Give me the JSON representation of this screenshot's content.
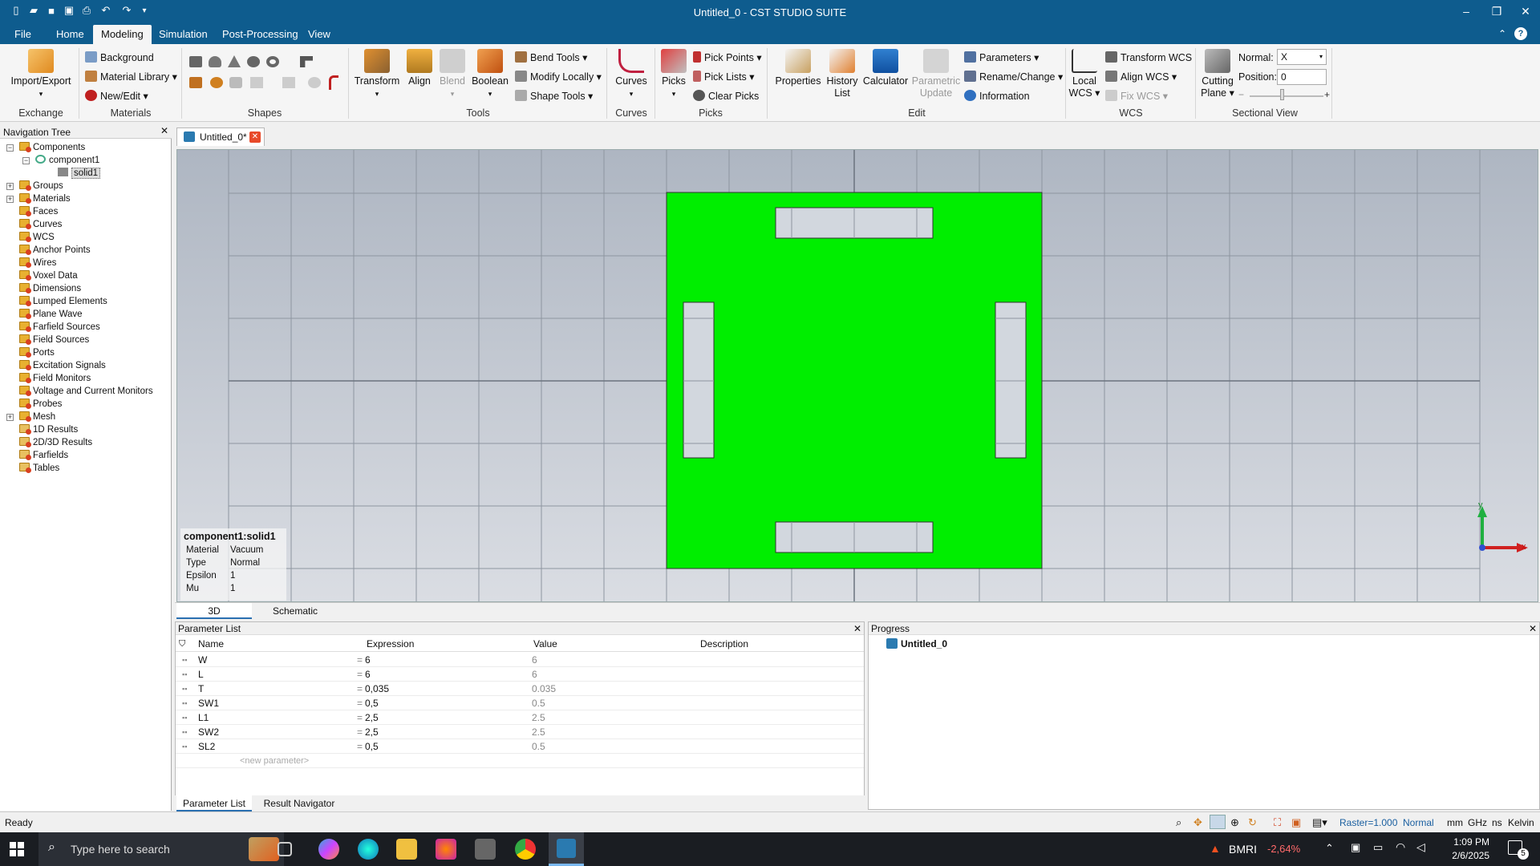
{
  "app": {
    "title": "Untitled_0 - CST STUDIO SUITE"
  },
  "menu": {
    "tabs": [
      "File",
      "Home",
      "Modeling",
      "Simulation",
      "Post-Processing",
      "View"
    ],
    "active": "Modeling"
  },
  "ribbon": {
    "exchange": {
      "import_export": "Import/Export",
      "label": "Exchange"
    },
    "materials": {
      "background": "Background",
      "material_library": "Material Library",
      "new_edit": "New/Edit",
      "label": "Materials"
    },
    "shapes": {
      "label": "Shapes"
    },
    "tools": {
      "transform": "Transform",
      "align": "Align",
      "blend": "Blend",
      "boolean": "Boolean",
      "bend_tools": "Bend Tools",
      "modify_locally": "Modify Locally",
      "shape_tools": "Shape Tools",
      "label": "Tools"
    },
    "curves": {
      "curves": "Curves",
      "label": "Curves"
    },
    "picks": {
      "picks": "Picks",
      "pick_points": "Pick Points",
      "pick_lists": "Pick Lists",
      "clear_picks": "Clear Picks",
      "label": "Picks"
    },
    "edit": {
      "properties": "Properties",
      "history_list": "History List",
      "calculator": "Calculator",
      "parametric_update": "Parametric Update",
      "parameters": "Parameters",
      "rename_change": "Rename/Change",
      "information": "Information",
      "label": "Edit"
    },
    "wcs": {
      "local_wcs": "Local WCS",
      "transform_wcs": "Transform WCS",
      "align_wcs": "Align WCS",
      "fix_wcs": "Fix WCS",
      "label": "WCS"
    },
    "sectional": {
      "cutting_plane": "Cutting Plane",
      "normal_label": "Normal:",
      "normal_value": "X",
      "position_label": "Position:",
      "position_value": "0",
      "label": "Sectional View"
    }
  },
  "nav": {
    "header": "Navigation Tree",
    "items": [
      "Components",
      "component1",
      "solid1",
      "Groups",
      "Materials",
      "Faces",
      "Curves",
      "WCS",
      "Anchor Points",
      "Wires",
      "Voxel Data",
      "Dimensions",
      "Lumped Elements",
      "Plane Wave",
      "Farfield Sources",
      "Field Sources",
      "Ports",
      "Excitation Signals",
      "Field Monitors",
      "Voltage and Current Monitors",
      "Probes",
      "Mesh",
      "1D Results",
      "2D/3D Results",
      "Farfields",
      "Tables"
    ]
  },
  "document": {
    "tab": "Untitled_0*"
  },
  "viewport": {
    "solid_color": "#00ee00",
    "info": {
      "title": "component1:solid1",
      "rows": [
        [
          "Material",
          "Vacuum"
        ],
        [
          "Type",
          "Normal"
        ],
        [
          "Epsilon",
          "1"
        ],
        [
          "Mu",
          "1"
        ]
      ]
    },
    "axis_y": "y",
    "axis_x": "x"
  },
  "view_tabs": [
    "3D",
    "Schematic"
  ],
  "parameter_list": {
    "title": "Parameter List",
    "columns": [
      "Name",
      "Expression",
      "Value",
      "Description"
    ],
    "rows": [
      {
        "name": "W",
        "expr": "6",
        "value": "6"
      },
      {
        "name": "L",
        "expr": "6",
        "value": "6"
      },
      {
        "name": "T",
        "expr": "0,035",
        "value": "0.035"
      },
      {
        "name": "SW1",
        "expr": "0,5",
        "value": "0.5"
      },
      {
        "name": "L1",
        "expr": "2,5",
        "value": "2.5"
      },
      {
        "name": "SW2",
        "expr": "2,5",
        "value": "2.5"
      },
      {
        "name": "SL2",
        "expr": "0,5",
        "value": "0.5"
      }
    ],
    "new_param": "<new parameter>",
    "tabs": [
      "Parameter List",
      "Result Navigator"
    ]
  },
  "progress": {
    "title": "Progress",
    "item": "Untitled_0"
  },
  "status": {
    "left": "Ready",
    "raster": "Raster=1.000",
    "mode": "Normal",
    "units": [
      "mm",
      "GHz",
      "ns",
      "Kelvin"
    ]
  },
  "taskbar": {
    "search": "Type here to search",
    "stock_name": "BMRI",
    "stock_change": "-2,64%",
    "time": "1:09 PM",
    "date": "2/6/2025",
    "notif": "5"
  }
}
